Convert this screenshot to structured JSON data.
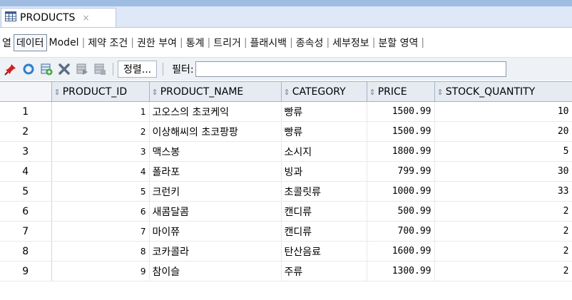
{
  "tab": {
    "title": "PRODUCTS",
    "close": "×"
  },
  "subtabs": [
    "열",
    "데이터",
    "Model",
    "제약 조건",
    "권한 부여",
    "통계",
    "트리거",
    "플래시백",
    "종속성",
    "세부정보",
    "분할 영역"
  ],
  "toolbar": {
    "sort_label": "정렬...",
    "filter_label": "필터:"
  },
  "table": {
    "columns": [
      "PRODUCT_ID",
      "PRODUCT_NAME",
      "CATEGORY",
      "PRICE",
      "STOCK_QUANTITY"
    ],
    "rows": [
      {
        "n": "1",
        "id": "1",
        "name": "고오스의 초코케익",
        "category": "빵류",
        "price": "1500.99",
        "stock": "10"
      },
      {
        "n": "2",
        "id": "2",
        "name": "이상해씨의 초코팡팡",
        "category": "빵류",
        "price": "1500.99",
        "stock": "20"
      },
      {
        "n": "3",
        "id": "3",
        "name": "맥스봉",
        "category": "소시지",
        "price": "1800.99",
        "stock": "5"
      },
      {
        "n": "4",
        "id": "4",
        "name": "폴라포",
        "category": "빙과",
        "price": "799.99",
        "stock": "30"
      },
      {
        "n": "5",
        "id": "5",
        "name": "크런키",
        "category": "초콜릿류",
        "price": "1000.99",
        "stock": "33"
      },
      {
        "n": "6",
        "id": "6",
        "name": "새콤달콤",
        "category": "캔디류",
        "price": "500.99",
        "stock": "2"
      },
      {
        "n": "7",
        "id": "7",
        "name": "마이쮸",
        "category": "캔디류",
        "price": "700.99",
        "stock": "2"
      },
      {
        "n": "8",
        "id": "8",
        "name": "코카콜라",
        "category": "탄산음료",
        "price": "1600.99",
        "stock": "2"
      },
      {
        "n": "9",
        "id": "9",
        "name": "참이슬",
        "category": "주류",
        "price": "1300.99",
        "stock": "2"
      }
    ]
  }
}
